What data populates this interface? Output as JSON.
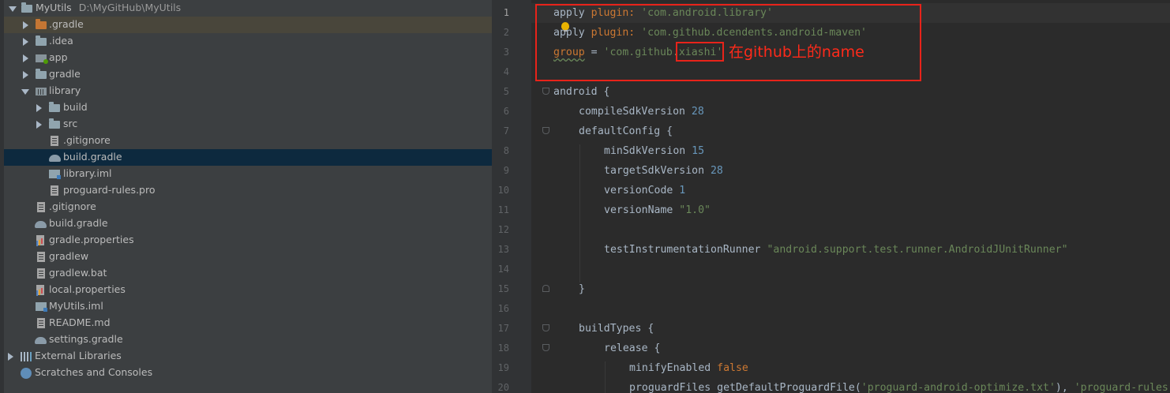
{
  "project_tree": {
    "root": {
      "name": "MyUtils",
      "path": "D:\\MyGitHub\\MyUtils"
    },
    "items": [
      {
        "label": ".gradle",
        "icon": "folder-orange-icon"
      },
      {
        "label": ".idea",
        "icon": "folder-icon"
      },
      {
        "label": "app",
        "icon": "module-icon"
      },
      {
        "label": "gradle",
        "icon": "folder-icon"
      },
      {
        "label": "library",
        "icon": "library-module-icon"
      },
      {
        "label": "build",
        "icon": "folder-icon"
      },
      {
        "label": "src",
        "icon": "folder-icon"
      },
      {
        "label": ".gitignore",
        "icon": "file-icon"
      },
      {
        "label": "build.gradle",
        "icon": "gradle-icon"
      },
      {
        "label": "library.iml",
        "icon": "iml-icon"
      },
      {
        "label": "proguard-rules.pro",
        "icon": "file-icon"
      },
      {
        "label": ".gitignore",
        "icon": "file-icon"
      },
      {
        "label": "build.gradle",
        "icon": "gradle-icon"
      },
      {
        "label": "gradle.properties",
        "icon": "properties-icon"
      },
      {
        "label": "gradlew",
        "icon": "file-icon"
      },
      {
        "label": "gradlew.bat",
        "icon": "file-icon"
      },
      {
        "label": "local.properties",
        "icon": "properties-icon"
      },
      {
        "label": "MyUtils.iml",
        "icon": "iml-icon"
      },
      {
        "label": "README.md",
        "icon": "file-icon"
      },
      {
        "label": "settings.gradle",
        "icon": "gradle-icon"
      },
      {
        "label": "External Libraries",
        "icon": "libraries-icon"
      },
      {
        "label": "Scratches and Consoles",
        "icon": "scratches-icon"
      }
    ],
    "selected_item": "build.gradle"
  },
  "editor": {
    "line_numbers": [
      "1",
      "2",
      "3",
      "4",
      "5",
      "6",
      "7",
      "8",
      "9",
      "10",
      "11",
      "12",
      "13",
      "14",
      "15",
      "16",
      "17",
      "18",
      "19",
      "20"
    ],
    "code": {
      "l1": {
        "kw": "apply",
        "key": " plugin: ",
        "str": "'com.android.library'"
      },
      "l2": {
        "kw": "apply",
        "key": " plugin: ",
        "str": "'com.github.dcendents.android-maven'"
      },
      "l3": {
        "kw": "group",
        "eq": " = ",
        "str_a": "'com.github.",
        "str_b": "xiashi",
        "str_c": "'"
      },
      "l5": {
        "text": "android {"
      },
      "l6": {
        "key": "compileSdkVersion ",
        "num": "28"
      },
      "l7": {
        "text": "defaultConfig {"
      },
      "l8": {
        "key": "minSdkVersion ",
        "num": "15"
      },
      "l9": {
        "key": "targetSdkVersion ",
        "num": "28"
      },
      "l10": {
        "key": "versionCode ",
        "num": "1"
      },
      "l11": {
        "key": "versionName ",
        "str": "\"1.0\""
      },
      "l13": {
        "key": "testInstrumentationRunner ",
        "str": "\"android.support.test.runner.AndroidJUnitRunner\""
      },
      "l15": {
        "text": "}"
      },
      "l17": {
        "text": "buildTypes {"
      },
      "l18": {
        "text": "release {"
      },
      "l19": {
        "key": "minifyEnabled ",
        "kw": "false"
      },
      "l20": {
        "key": "proguardFiles getDefaultProguardFile(",
        "str": "'proguard-android-optimize.txt'",
        "mid": "), ",
        "str2": "'proguard-rules"
      }
    },
    "annotation_text": "在github上的name",
    "annotation_color": "#e8231a"
  },
  "colors": {
    "keyword": "#cc7832",
    "string": "#6a8759",
    "number": "#6897bb",
    "selection": "#0d293e"
  }
}
